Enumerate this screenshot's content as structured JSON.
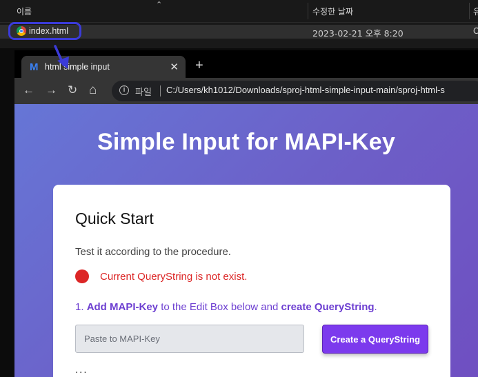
{
  "explorer": {
    "columns": {
      "name": "이름",
      "date_modified": "수정한 날짜",
      "type_cut": "유"
    },
    "file": {
      "name": "index.html",
      "date": "2023-02-21 오후 8:20",
      "type_cut": "C"
    }
  },
  "browser": {
    "tab": {
      "logo": "M",
      "title": "html simple input",
      "close": "✕"
    },
    "new_tab": "+",
    "nav": {
      "back": "←",
      "forward": "→",
      "reload": "↻",
      "home": "⌂"
    },
    "address": {
      "info_icon": "i",
      "protocol": "파일",
      "url": "C:/Users/kh1012/Downloads/sproj-html-simple-input-main/sproj-html-s"
    }
  },
  "page": {
    "heading": "Simple Input for MAPI-Key",
    "card": {
      "title": "Quick Start",
      "description": "Test it according to the procedure.",
      "status": "Current QueryString is not exist.",
      "step": {
        "num": "1. ",
        "bold1": "Add MAPI-Key",
        "mid": " to the Edit Box below and ",
        "bold2": "create QueryString",
        "end": "."
      },
      "input_placeholder": "Paste to MAPI-Key",
      "button": "Create a QueryString",
      "ellipsis": "..."
    }
  },
  "colors": {
    "highlight": "#3b3bd9",
    "status_red": "#dc2626",
    "accent_purple": "#7c3aed",
    "step_purple": "#6d3fd1"
  }
}
